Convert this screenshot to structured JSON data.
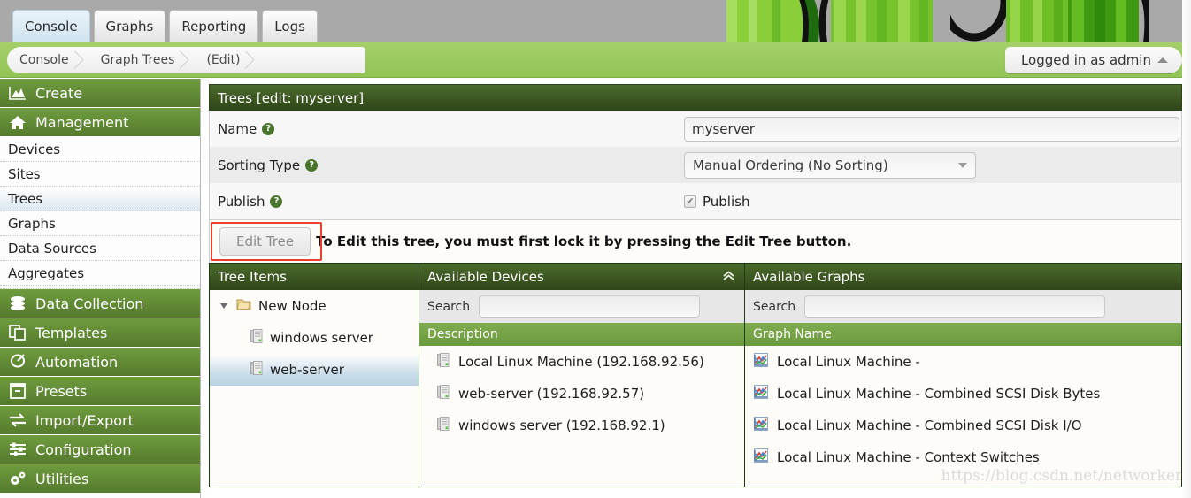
{
  "topbar": {
    "tabs": [
      {
        "label": "Console",
        "active": true
      },
      {
        "label": "Graphs",
        "active": false
      },
      {
        "label": "Reporting",
        "active": false
      },
      {
        "label": "Logs",
        "active": false
      }
    ]
  },
  "breadcrumb": {
    "items": [
      "Console",
      "Graph Trees",
      "(Edit)"
    ],
    "login_label": "Logged in as admin",
    "caret_icon": "caret-up-icon"
  },
  "sidebar": {
    "groups": [
      {
        "label": "Create",
        "icon": "chart-area-icon",
        "items": []
      },
      {
        "label": "Management",
        "icon": "home-icon",
        "items": [
          "Devices",
          "Sites",
          "Trees",
          "Graphs",
          "Data Sources",
          "Aggregates"
        ]
      },
      {
        "label": "Data Collection",
        "icon": "database-icon",
        "items": []
      },
      {
        "label": "Templates",
        "icon": "copy-icon",
        "items": []
      },
      {
        "label": "Automation",
        "icon": "lasso-icon",
        "items": []
      },
      {
        "label": "Presets",
        "icon": "archive-icon",
        "items": []
      },
      {
        "label": "Import/Export",
        "icon": "exchange-icon",
        "items": []
      },
      {
        "label": "Configuration",
        "icon": "sliders-icon",
        "items": []
      },
      {
        "label": "Utilities",
        "icon": "gears-icon",
        "items": []
      }
    ],
    "selected_item": "Trees"
  },
  "form": {
    "panel_title": "Trees [edit: myserver]",
    "name_label": "Name",
    "name_value": "myserver",
    "sorting_label": "Sorting Type",
    "sorting_value": "Manual Ordering (No Sorting)",
    "publish_label": "Publish",
    "publish_checkbox_label": "Publish",
    "publish_checked": true,
    "help_icon": "question-mark-icon",
    "edit_button": "Edit Tree",
    "edit_message": "To Edit this tree, you must first lock it by pressing the Edit Tree button.",
    "highlight_color": "#e8402f"
  },
  "tree_panel": {
    "title": "Tree Items",
    "items": [
      {
        "label": "New Node",
        "icon": "folder-icon",
        "level": 0,
        "expanded": true,
        "selected": false
      },
      {
        "label": "windows server",
        "icon": "device-icon",
        "level": 1,
        "expanded": false,
        "selected": false
      },
      {
        "label": "web-server",
        "icon": "device-icon",
        "level": 1,
        "expanded": false,
        "selected": true
      }
    ]
  },
  "devices_panel": {
    "title": "Available Devices",
    "collapse_icon": "chevron-double-up-icon",
    "search_label": "Search",
    "search_value": "",
    "column_header": "Description",
    "rows": [
      {
        "label": "Local Linux Machine (192.168.92.56)",
        "icon": "device-icon"
      },
      {
        "label": "web-server (192.168.92.57)",
        "icon": "device-icon"
      },
      {
        "label": "windows server (192.168.92.1)",
        "icon": "device-icon"
      }
    ]
  },
  "graphs_panel": {
    "title": "Available Graphs",
    "search_label": "Search",
    "search_value": "",
    "column_header": "Graph Name",
    "rows": [
      {
        "label": "Local Linux Machine -",
        "icon": "graph-icon"
      },
      {
        "label": "Local Linux Machine - Combined SCSI Disk Bytes",
        "icon": "graph-icon"
      },
      {
        "label": "Local Linux Machine - Combined SCSI Disk I/O",
        "icon": "graph-icon"
      },
      {
        "label": "Local Linux Machine - Context Switches",
        "icon": "graph-icon"
      }
    ]
  },
  "watermark": "https://blog.csdn.net/networken"
}
